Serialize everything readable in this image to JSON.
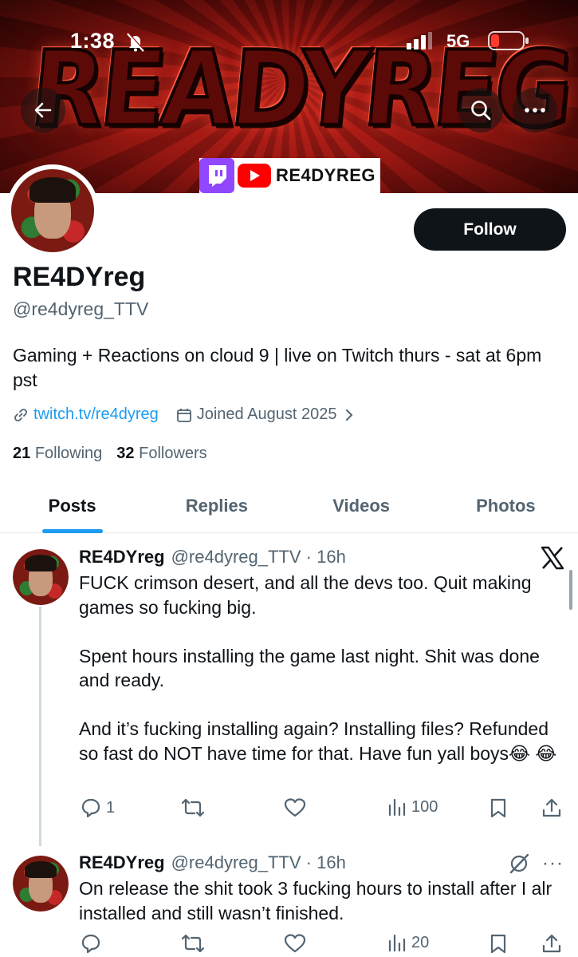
{
  "status_bar": {
    "time": "1:38",
    "network": "5G"
  },
  "banner": {
    "logo_text": "READYREG",
    "stream_badge": "RE4DYREG",
    "icons": [
      "back-arrow-icon",
      "search-icon",
      "more-icon",
      "twitch-icon",
      "youtube-icon"
    ]
  },
  "profile": {
    "display_name": "RE4DYreg",
    "handle": "@re4dyreg_TTV",
    "bio": "Gaming + Reactions on cloud 9 | live on Twitch thurs - sat at 6pm pst",
    "link": "twitch.tv/re4dyreg",
    "joined": "Joined August 2025",
    "following_count": "21",
    "following_label": "Following",
    "followers_count": "32",
    "followers_label": "Followers",
    "follow_label": "Follow"
  },
  "tabs": [
    {
      "label": "Posts",
      "active": true
    },
    {
      "label": "Replies",
      "active": false
    },
    {
      "label": "Videos",
      "active": false
    },
    {
      "label": "Photos",
      "active": false
    }
  ],
  "posts": [
    {
      "name": "RE4DYreg",
      "handle_time": "@re4dyreg_TTV · 16h",
      "body": "FUCK crimson desert, and all the devs too. Quit making games so fucking big.\n\nSpent hours installing the game last night. Shit was done and ready.\n\nAnd it’s fucking installing again? Installing files? Refunded so fast do NOT have time for that. Have fun yall boys😂 😂",
      "replies": "1",
      "reposts": "",
      "likes": "",
      "views": "100"
    },
    {
      "name": "RE4DYreg",
      "handle_time": "@re4dyreg_TTV · 16h",
      "body": "On release the shit took 3 fucking hours to install after I alr installed and still wasn’t finished.",
      "replies": "",
      "reposts": "",
      "likes": "",
      "views": "20"
    }
  ],
  "colors": {
    "accent": "#1d9bf0",
    "follow_button": "#0f1419",
    "muted_text": "#536471",
    "twitch": "#9146ff",
    "youtube": "#ff0000"
  }
}
